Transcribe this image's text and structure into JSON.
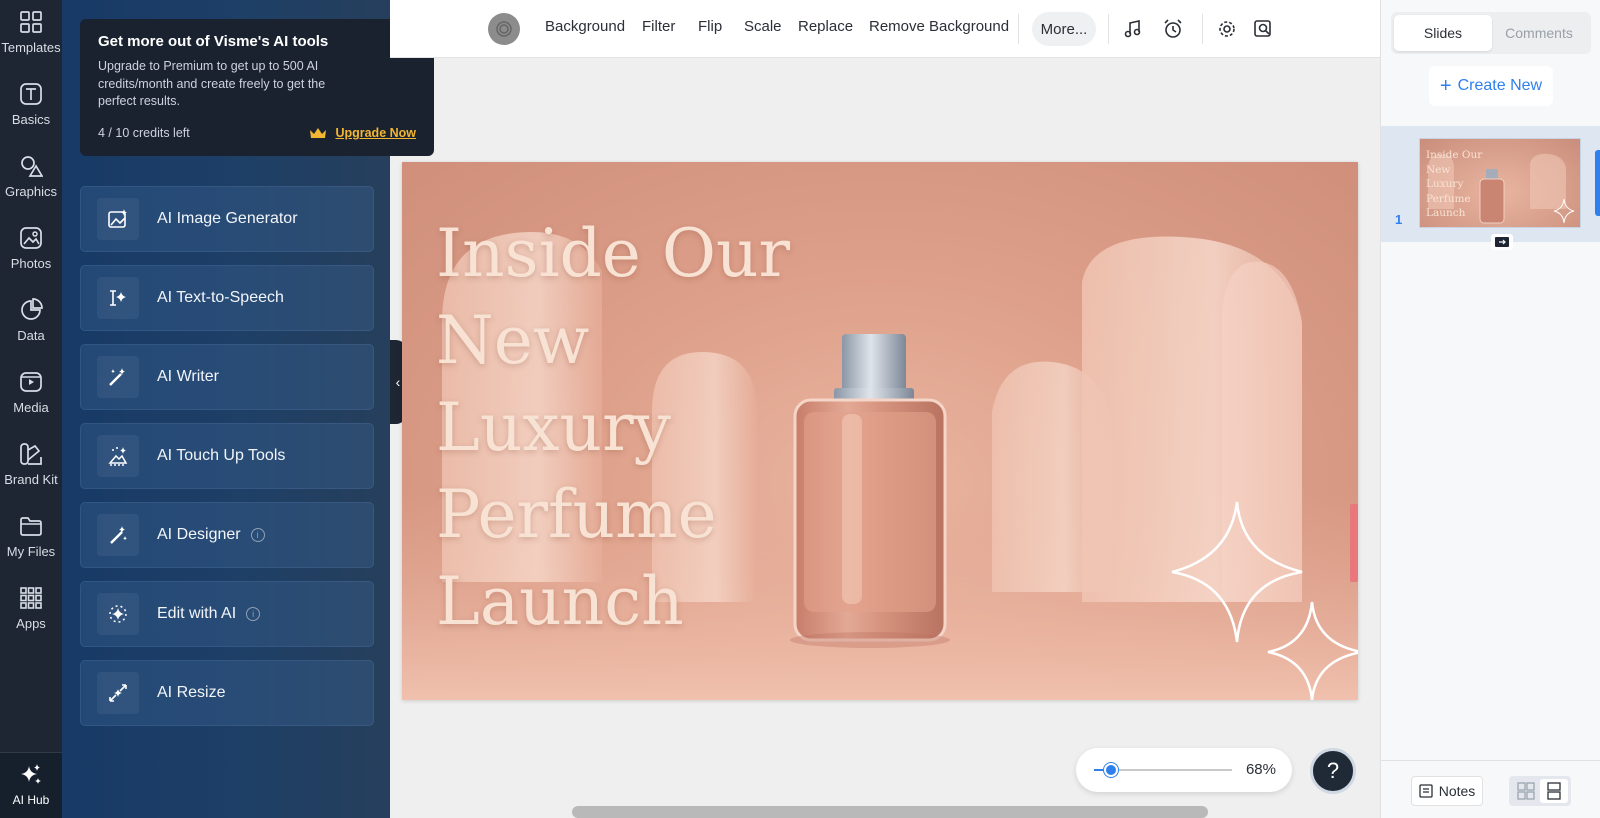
{
  "rail": {
    "items": [
      {
        "label": "Templates",
        "icon": "templates-icon"
      },
      {
        "label": "Basics",
        "icon": "text-icon"
      },
      {
        "label": "Graphics",
        "icon": "graphics-icon"
      },
      {
        "label": "Photos",
        "icon": "photos-icon"
      },
      {
        "label": "Data",
        "icon": "pie-chart-icon"
      },
      {
        "label": "Media",
        "icon": "media-icon"
      },
      {
        "label": "Brand Kit",
        "icon": "brand-kit-icon"
      },
      {
        "label": "My Files",
        "icon": "folder-icon"
      },
      {
        "label": "Apps",
        "icon": "apps-grid-icon"
      }
    ],
    "ai_hub_label": "AI Hub"
  },
  "promo": {
    "title": "Get more out of Visme's AI tools",
    "body": "Upgrade to Premium to get up to 500 AI credits/month and create freely to get the perfect results.",
    "credits": "4 / 10 credits left",
    "upgrade_label": "Upgrade Now",
    "accent": "#f2b632"
  },
  "ai_tools": [
    {
      "label": "AI Image Generator",
      "info": false
    },
    {
      "label": "AI Text-to-Speech",
      "info": false
    },
    {
      "label": "AI Writer",
      "info": false
    },
    {
      "label": "AI Touch Up Tools",
      "info": false
    },
    {
      "label": "AI Designer",
      "info": true
    },
    {
      "label": "Edit with AI",
      "info": true
    },
    {
      "label": "AI Resize",
      "info": false
    }
  ],
  "toolbar": {
    "buttons": [
      "Background",
      "Filter",
      "Flip",
      "Scale",
      "Replace",
      "Remove Background"
    ],
    "more_label": "More...",
    "info_glyph": "i"
  },
  "slide": {
    "title_lines": [
      "Inside Our",
      "New",
      "Luxury",
      "Perfume",
      "Launch"
    ]
  },
  "zoom": {
    "value_label": "68%",
    "level": 0.12,
    "accent": "#2f80ed"
  },
  "help_label": "?",
  "right_panel": {
    "tabs": [
      "Slides",
      "Comments"
    ],
    "create_new": "Create New",
    "slide_number": "1",
    "notes_label": "Notes"
  }
}
